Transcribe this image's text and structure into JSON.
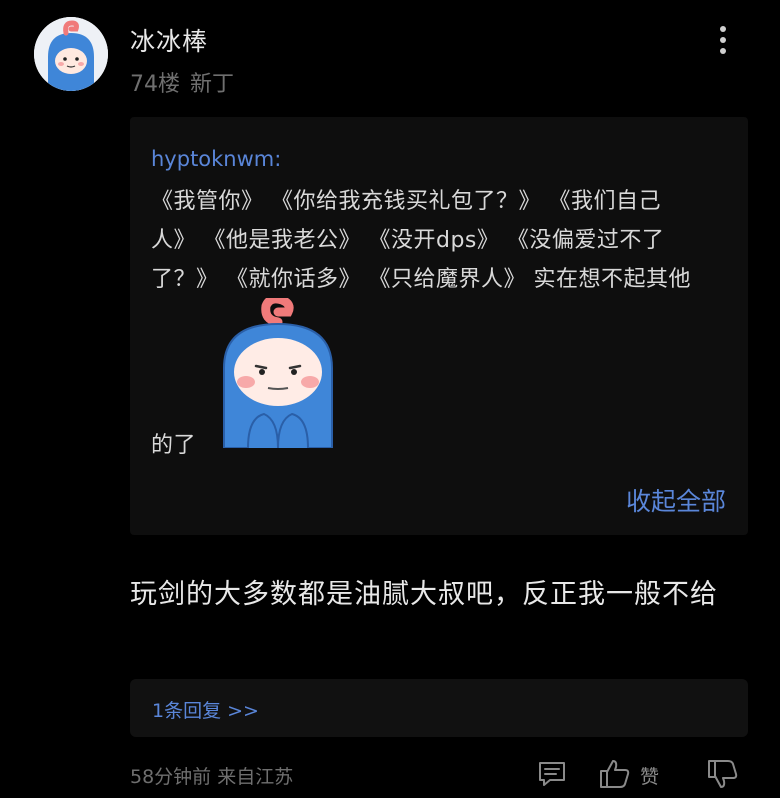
{
  "post": {
    "username": "冰冰棒",
    "floor": "74楼",
    "badge": "新丁"
  },
  "quote": {
    "quoted_user": "hyptoknwm:",
    "lines": [
      "《我管你》 《你给我充钱买礼包了？》 《我们自己",
      "人》 《他是我老公》 《没开dps》 《没偏爱过不了",
      "了？》 《就你话多》 《只给魔界人》 实在想不起其他",
      "的了"
    ],
    "collapse_label": "收起全部"
  },
  "content": {
    "text": "玩剑的大多数都是油腻大叔吧，反正我一般不给"
  },
  "replies": {
    "label": "1条回复 >>"
  },
  "footer": {
    "time": "58分钟前",
    "location": "来自江苏",
    "like_label": "赞"
  },
  "colors": {
    "background": "#000000",
    "accent_link": "#5a86d9",
    "quote_bg": "#0e0e0e"
  }
}
